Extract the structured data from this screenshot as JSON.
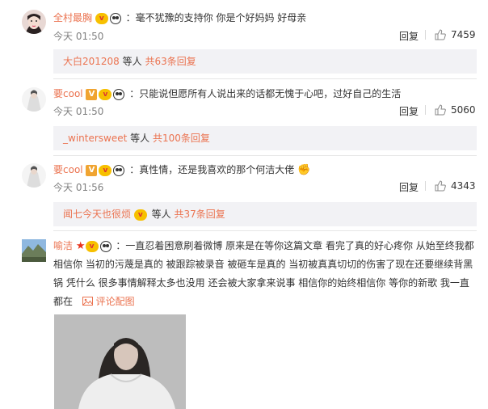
{
  "comments": [
    {
      "user": "全村最胸",
      "text": "：毫不犹豫的支持你 你是个好妈妈 好母亲",
      "time": "今天 01:50",
      "reply_label": "回复",
      "likes": "7459",
      "replies": {
        "user": "大白201208",
        "middle": " 等人 ",
        "count": "共63条回复"
      }
    },
    {
      "user": "要cool",
      "text": "：只能说但愿所有人说出来的话都无愧于心吧，过好自己的生活",
      "time": "今天 01:50",
      "reply_label": "回复",
      "likes": "5060",
      "replies": {
        "user": "_wintersweet",
        "middle": " 等人 ",
        "count": "共100条回复"
      }
    },
    {
      "user": "要cool",
      "text": "：真性情，还是我喜欢的那个何洁大佬",
      "time": "今天 01:56",
      "reply_label": "回复",
      "likes": "4343",
      "replies": {
        "user": "闻七今天也很烦",
        "middle": " 等人 ",
        "count": "共37条回复"
      }
    },
    {
      "user": "喻洁",
      "text_lines": [
        "：一直忍着困意刷着微博 原来是在等你这篇文章 看完了真的好心疼你 从始至终我都",
        "相信你 当初的污蔑是真的 被跟踪被录音 被砸车是真的 当初被真真切切的伤害了现在还要继续背黑",
        "锅 凭什么 很多事情解释太多也没用 还会被大家拿来说事 相信你的始终相信你 等你的新歌 我一直",
        "都在"
      ],
      "pic_link": "评论配图"
    }
  ],
  "colors": {
    "link": "#eb7350",
    "reply_bg": "#f2f2f5"
  }
}
